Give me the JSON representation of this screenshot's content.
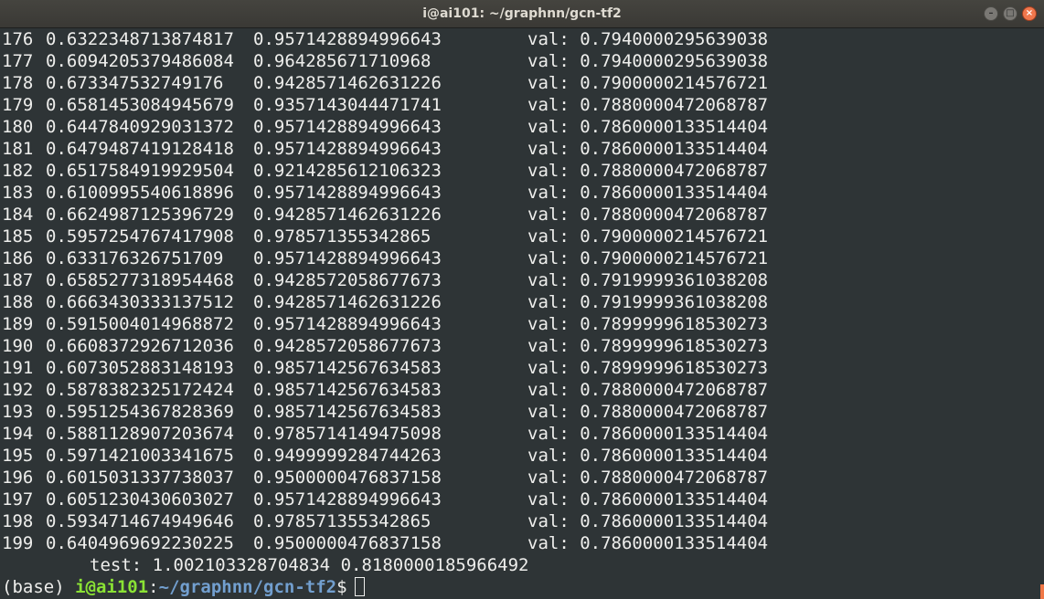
{
  "window": {
    "title": "i@ai101: ~/graphnn/gcn-tf2"
  },
  "controls": {
    "minimize": "–",
    "maximize": "□",
    "close": "×"
  },
  "rows": [
    {
      "epoch": "176",
      "loss": "0.6322348713874817",
      "acc": "0.9571428894996643",
      "val_label": "val:",
      "val": "0.7940000295639038"
    },
    {
      "epoch": "177",
      "loss": "0.6094205379486084",
      "acc": "0.964285671710968",
      "val_label": "val:",
      "val": "0.7940000295639038"
    },
    {
      "epoch": "178",
      "loss": "0.673347532749176",
      "acc": "0.9428571462631226",
      "val_label": "val:",
      "val": "0.7900000214576721"
    },
    {
      "epoch": "179",
      "loss": "0.6581453084945679",
      "acc": "0.9357143044471741",
      "val_label": "val:",
      "val": "0.7880000472068787"
    },
    {
      "epoch": "180",
      "loss": "0.6447840929031372",
      "acc": "0.9571428894996643",
      "val_label": "val:",
      "val": "0.7860000133514404"
    },
    {
      "epoch": "181",
      "loss": "0.6479487419128418",
      "acc": "0.9571428894996643",
      "val_label": "val:",
      "val": "0.7860000133514404"
    },
    {
      "epoch": "182",
      "loss": "0.6517584919929504",
      "acc": "0.9214285612106323",
      "val_label": "val:",
      "val": "0.7880000472068787"
    },
    {
      "epoch": "183",
      "loss": "0.6100995540618896",
      "acc": "0.9571428894996643",
      "val_label": "val:",
      "val": "0.7860000133514404"
    },
    {
      "epoch": "184",
      "loss": "0.6624987125396729",
      "acc": "0.9428571462631226",
      "val_label": "val:",
      "val": "0.7880000472068787"
    },
    {
      "epoch": "185",
      "loss": "0.5957254767417908",
      "acc": "0.978571355342865",
      "val_label": "val:",
      "val": "0.7900000214576721"
    },
    {
      "epoch": "186",
      "loss": "0.633176326751709",
      "acc": "0.9571428894996643",
      "val_label": "val:",
      "val": "0.7900000214576721"
    },
    {
      "epoch": "187",
      "loss": "0.6585277318954468",
      "acc": "0.9428572058677673",
      "val_label": "val:",
      "val": "0.7919999361038208"
    },
    {
      "epoch": "188",
      "loss": "0.6663430333137512",
      "acc": "0.9428571462631226",
      "val_label": "val:",
      "val": "0.7919999361038208"
    },
    {
      "epoch": "189",
      "loss": "0.5915004014968872",
      "acc": "0.9571428894996643",
      "val_label": "val:",
      "val": "0.7899999618530273"
    },
    {
      "epoch": "190",
      "loss": "0.6608372926712036",
      "acc": "0.9428572058677673",
      "val_label": "val:",
      "val": "0.7899999618530273"
    },
    {
      "epoch": "191",
      "loss": "0.6073052883148193",
      "acc": "0.9857142567634583",
      "val_label": "val:",
      "val": "0.7899999618530273"
    },
    {
      "epoch": "192",
      "loss": "0.5878382325172424",
      "acc": "0.9857142567634583",
      "val_label": "val:",
      "val": "0.7880000472068787"
    },
    {
      "epoch": "193",
      "loss": "0.5951254367828369",
      "acc": "0.9857142567634583",
      "val_label": "val:",
      "val": "0.7880000472068787"
    },
    {
      "epoch": "194",
      "loss": "0.5881128907203674",
      "acc": "0.9785714149475098",
      "val_label": "val:",
      "val": "0.7860000133514404"
    },
    {
      "epoch": "195",
      "loss": "0.5971421003341675",
      "acc": "0.9499999284744263",
      "val_label": "val:",
      "val": "0.7860000133514404"
    },
    {
      "epoch": "196",
      "loss": "0.6015031337738037",
      "acc": "0.9500000476837158",
      "val_label": "val:",
      "val": "0.7880000472068787"
    },
    {
      "epoch": "197",
      "loss": "0.6051230430603027",
      "acc": "0.9571428894996643",
      "val_label": "val:",
      "val": "0.7860000133514404"
    },
    {
      "epoch": "198",
      "loss": "0.5934714674949646",
      "acc": "0.978571355342865",
      "val_label": "val:",
      "val": "0.7860000133514404"
    },
    {
      "epoch": "199",
      "loss": "0.6404969692230225",
      "acc": "0.9500000476837158",
      "val_label": "val:",
      "val": "0.7860000133514404"
    }
  ],
  "test": {
    "label": "test:",
    "loss": "1.002103328704834",
    "acc": "0.8180000185966492"
  },
  "prompt": {
    "env": "(base)",
    "user": "i@ai101",
    "sep": ":",
    "path": "~/graphnn/gcn-tf2",
    "symbol": "$"
  },
  "colors": {
    "terminal_bg": "#2e3436",
    "text": "#eeeeec",
    "user_green": "#8ae234",
    "path_blue": "#729fcf",
    "close_orange": "#f0774d"
  }
}
